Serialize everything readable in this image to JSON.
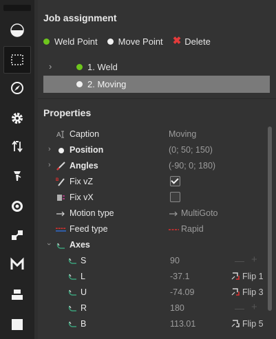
{
  "toolbar": {
    "tools": [
      {
        "name": "pie-icon"
      },
      {
        "name": "dotted-rect-icon",
        "active": true
      },
      {
        "name": "compass-icon"
      },
      {
        "name": "gear-icon"
      },
      {
        "name": "flip-arrows-icon"
      },
      {
        "name": "torch-icon"
      },
      {
        "name": "target-icon"
      },
      {
        "name": "link-icon"
      },
      {
        "name": "m-logo-icon"
      },
      {
        "name": "stack-icon"
      },
      {
        "name": "square-icon"
      }
    ]
  },
  "job": {
    "title": "Job assignment",
    "weld_point_label": "Weld Point",
    "move_point_label": "Move Point",
    "delete_label": "Delete",
    "items": [
      {
        "label": "1. Weld",
        "dot": "green",
        "selected": false
      },
      {
        "label": "2. Moving",
        "dot": "white",
        "selected": true
      }
    ]
  },
  "properties": {
    "title": "Properties",
    "caption": {
      "label": "Caption",
      "value": "Moving"
    },
    "position": {
      "label": "Position",
      "value": "(0; 50; 150)"
    },
    "angles": {
      "label": "Angles",
      "value": "(-90; 0; 180)"
    },
    "fix_vz": {
      "label": "Fix vZ",
      "checked": true
    },
    "fix_vx": {
      "label": "Fix vX",
      "checked": false
    },
    "motion_type": {
      "label": "Motion type",
      "value": "MultiGoto"
    },
    "feed_type": {
      "label": "Feed type",
      "value": "Rapid"
    },
    "axes": {
      "label": "Axes",
      "rows": [
        {
          "name": "S",
          "value": "90",
          "control": "stepper"
        },
        {
          "name": "L",
          "value": "-37.1",
          "control": "flip",
          "flip_label": "Flip 1"
        },
        {
          "name": "U",
          "value": "-74.09",
          "control": "flip",
          "flip_label": "Flip 3"
        },
        {
          "name": "R",
          "value": "180",
          "control": "stepper"
        },
        {
          "name": "B",
          "value": "113.01",
          "control": "flip",
          "flip_label": "Flip 5"
        }
      ]
    }
  },
  "colors": {
    "accent_green": "#6ec61d",
    "delete_red": "#e43b3b",
    "feed_red": "#e03030",
    "selected_row": "#7a7a7a"
  }
}
